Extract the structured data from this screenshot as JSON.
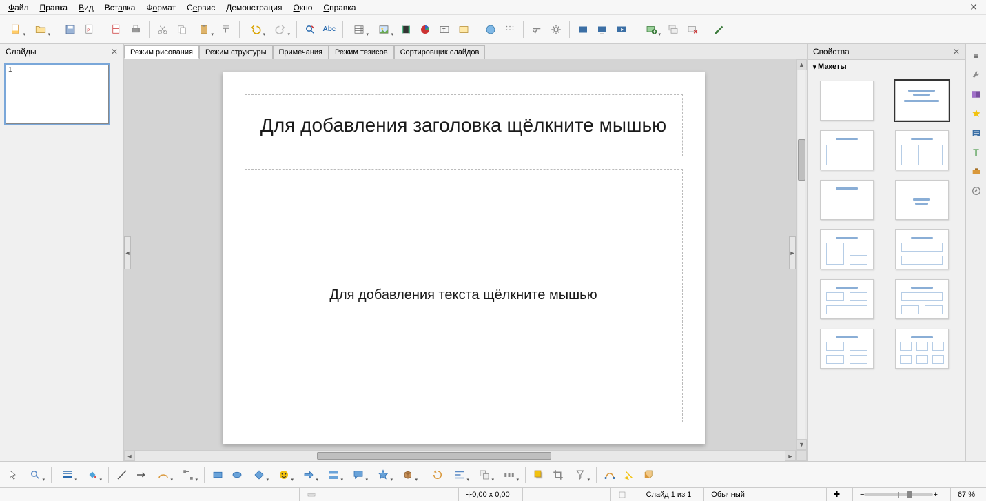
{
  "menu": {
    "items": [
      "Файл",
      "Правка",
      "Вид",
      "Вставка",
      "Формат",
      "Сервис",
      "Демонстрация",
      "Окно",
      "Справка"
    ]
  },
  "slides_panel": {
    "title": "Слайды",
    "slides": [
      {
        "num": "1"
      }
    ]
  },
  "tabs": {
    "items": [
      "Режим рисования",
      "Режим структуры",
      "Примечания",
      "Режим тезисов",
      "Сортировщик слайдов"
    ],
    "active_index": 0
  },
  "slide": {
    "title_ph": "Для добавления заголовка щёлкните мышью",
    "content_ph": "Для добавления текста щёлкните мышью"
  },
  "properties": {
    "title": "Свойства",
    "section_layouts": "Макеты",
    "selected_layout_index": 1
  },
  "statusbar": {
    "coords": "0,00 x 0,00",
    "slide_info": "Слайд 1 из 1",
    "mode": "Обычный",
    "zoom": "67 %"
  },
  "icons": {
    "new": "new-doc",
    "open": "open",
    "save": "save",
    "export": "export-pdf",
    "spell": "Abc"
  }
}
